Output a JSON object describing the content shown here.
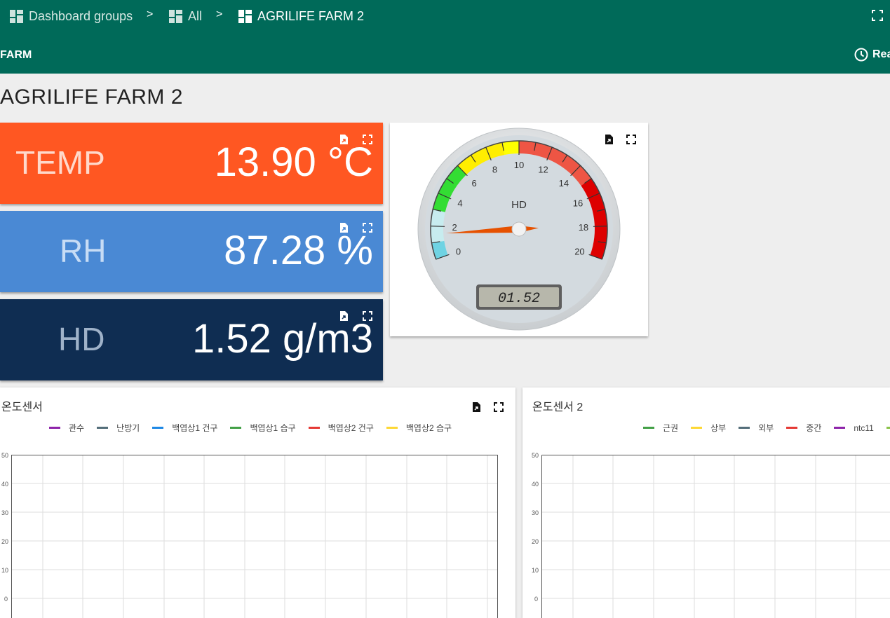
{
  "breadcrumb": {
    "items": [
      {
        "label": "Dashboard groups"
      },
      {
        "label": "All"
      },
      {
        "label": "AGRILIFE FARM 2"
      }
    ],
    "separator": ">"
  },
  "subheader": {
    "title": "FARM",
    "realtime_label": "Rea"
  },
  "page_title": "AGRILIFE FARM 2",
  "cards": {
    "temp": {
      "label": "TEMP",
      "value": "13.90 °C",
      "color": "#ff5722"
    },
    "rh": {
      "label": "RH",
      "value": "87.28 %",
      "color": "#4a89d4"
    },
    "hd": {
      "label": "HD",
      "value": "1.52 g/m3",
      "color": "#0f2d52"
    }
  },
  "gauge": {
    "title": "HD",
    "min": 0,
    "max": 20,
    "value": 1.52,
    "display": "01.52",
    "tick_labels": [
      "0",
      "2",
      "4",
      "6",
      "8",
      "10",
      "12",
      "14",
      "16",
      "18",
      "20"
    ]
  },
  "chart1": {
    "title": "온도센서",
    "legend": [
      {
        "name": "관수",
        "color": "#8e24aa"
      },
      {
        "name": "난방기",
        "color": "#546e7a"
      },
      {
        "name": "백엽상1 건구",
        "color": "#1e88e5"
      },
      {
        "name": "백엽상1 습구",
        "color": "#43a047"
      },
      {
        "name": "백엽상2 건구",
        "color": "#e53935"
      },
      {
        "name": "백엽상2 습구",
        "color": "#fdd835"
      }
    ],
    "y_ticks": [
      "50",
      "40",
      "30",
      "20",
      "10",
      "0"
    ]
  },
  "chart2": {
    "title": "온도센서 2",
    "legend": [
      {
        "name": "근권",
        "color": "#43a047"
      },
      {
        "name": "상부",
        "color": "#fdd835"
      },
      {
        "name": "외부",
        "color": "#546e7a"
      },
      {
        "name": "중간",
        "color": "#e53935"
      },
      {
        "name": "ntc11",
        "color": "#8e24aa"
      },
      {
        "name": "",
        "color": "#8bc34a"
      }
    ],
    "y_ticks": [
      "50",
      "40",
      "30",
      "20",
      "10",
      "0"
    ]
  }
}
